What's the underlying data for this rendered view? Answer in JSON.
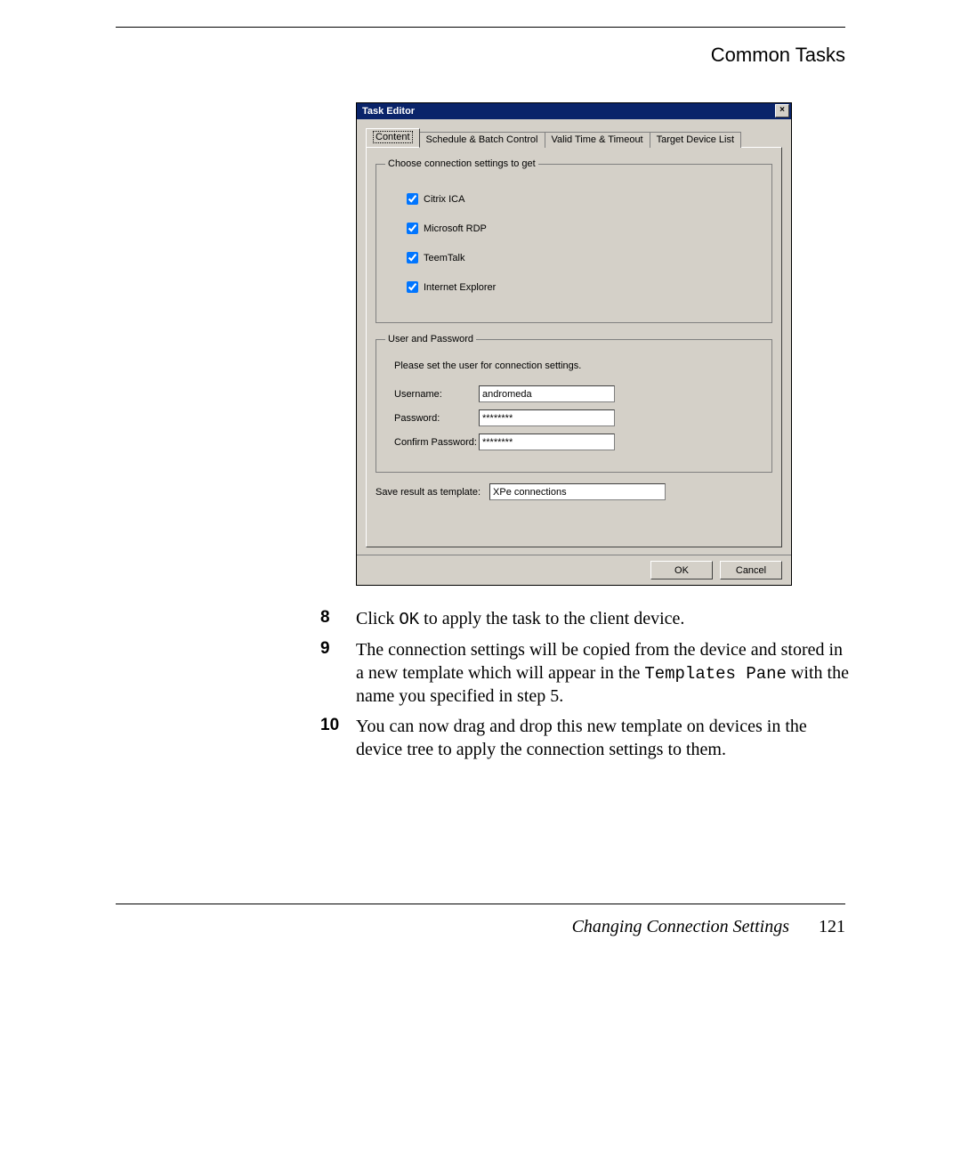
{
  "header": {
    "section": "Common Tasks"
  },
  "dialog": {
    "title": "Task Editor",
    "close_glyph": "×",
    "tabs": [
      "Content",
      "Schedule & Batch Control",
      "Valid Time & Timeout",
      "Target Device List"
    ],
    "groupbox1_legend": "Choose connection settings to get",
    "checkboxes": [
      {
        "label": "Citrix ICA",
        "checked": true
      },
      {
        "label": "Microsoft RDP",
        "checked": true
      },
      {
        "label": "TeemTalk",
        "checked": true
      },
      {
        "label": "Internet Explorer",
        "checked": true
      }
    ],
    "groupbox2_legend": "User and Password",
    "instruction": "Please set the user for connection settings.",
    "username_label": "Username:",
    "username_value": "andromeda",
    "password_label": "Password:",
    "password_value": "********",
    "confirm_label": "Confirm Password:",
    "confirm_value": "********",
    "save_label": "Save result as template:",
    "save_value": "XPe connections",
    "ok": "OK",
    "cancel": "Cancel"
  },
  "steps": {
    "s8_num": "8",
    "s8a": "Click ",
    "s8_ok": "OK",
    "s8b": " to apply the task to the client device.",
    "s9_num": "9",
    "s9a": "The connection settings will be copied from the device and stored in a new template which will appear in the ",
    "s9_tpl": "Templates Pane",
    "s9b": " with the name you specified in step 5.",
    "s10_num": "10",
    "s10": "You can now drag and drop this new template on devices in the device tree to apply the connection settings to them."
  },
  "footer": {
    "title": "Changing Connection Settings",
    "page": "121"
  }
}
